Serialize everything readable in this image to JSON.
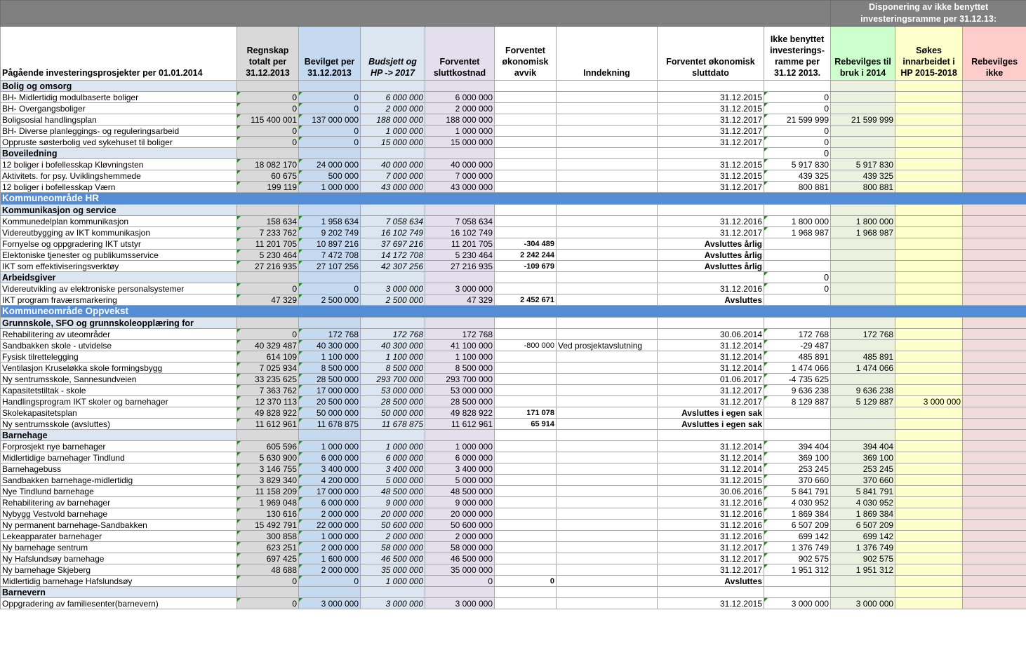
{
  "top_header": {
    "disposition": "Disponering  av ikke benyttet investeringsramme per 31.12.13:"
  },
  "columns": {
    "project": "Pågående investeringsprosjekter per 01.01.2014",
    "regnskap": "Regnskap totalt per 31.12.2013",
    "bevilget": "Bevilget per 31.12.2013",
    "budsjett": "Budsjett og HP -> 2017",
    "forventet_kost": "Forventet sluttkostnad",
    "forventet_avvik": "Forventet økonomisk avvik",
    "inndekning": "Inndekning",
    "sluttdato": "Forventet økonomisk sluttdato",
    "ikke_benyttet": "Ikke benyttet investerings-ramme per 31.12 2013.",
    "rebevilges_2014": "Rebevilges til bruk i 2014",
    "sokes_hp": "Søkes innarbeidet i HP 2015-2018",
    "rebevilges_ikke": "Rebevilges ikke"
  },
  "rows": [
    {
      "t": "sec",
      "name": "Bolig og omsorg"
    },
    {
      "t": "d",
      "name": "BH- Midlertidig modulbaserte boliger",
      "r": "0",
      "bv": "0",
      "bu": "6 000 000",
      "fk": "6 000 000",
      "av": "",
      "in": "",
      "sd": "31.12.2015",
      "ib": "0",
      "rb": "",
      "sk": "",
      "rk": ""
    },
    {
      "t": "d",
      "name": "BH- Overgangsboliger",
      "r": "0",
      "bv": "0",
      "bu": "2 000 000",
      "fk": "2 000 000",
      "av": "",
      "in": "",
      "sd": "31.12.2015",
      "ib": "0",
      "rb": "",
      "sk": "",
      "rk": ""
    },
    {
      "t": "d",
      "name": "Boligsosial handlingsplan",
      "r": "115 400 001",
      "bv": "137 000 000",
      "bu": "188 000 000",
      "fk": "188 000 000",
      "av": "",
      "in": "",
      "sd": "31.12.2017",
      "ib": "21 599 999",
      "rb": "21 599 999",
      "sk": "",
      "rk": ""
    },
    {
      "t": "d",
      "name": "BH- Diverse planleggings- og reguleringsarbeid",
      "r": "0",
      "bv": "0",
      "bu": "1 000 000",
      "fk": "1 000 000",
      "av": "",
      "in": "",
      "sd": "31.12.2017",
      "ib": "0",
      "rb": "",
      "sk": "",
      "rk": ""
    },
    {
      "t": "d",
      "name": "Oppruste søsterbolig ved sykehuset til boliger",
      "r": "0",
      "bv": "0",
      "bu": "15 000 000",
      "fk": "15 000 000",
      "av": "",
      "in": "",
      "sd": "31.12.2017",
      "ib": "0",
      "rb": "",
      "sk": "",
      "rk": ""
    },
    {
      "t": "sec",
      "name": "Boveiledning",
      "ib": "0"
    },
    {
      "t": "d",
      "name": "12 boliger i bofellesskap Kløvningsten",
      "r": "18 082 170",
      "bv": "24 000 000",
      "bu": "40 000 000",
      "fk": "40 000 000",
      "av": "",
      "in": "",
      "sd": "31.12.2015",
      "ib": "5 917 830",
      "rb": "5 917 830",
      "sk": "",
      "rk": ""
    },
    {
      "t": "d",
      "name": "Aktivitets. for psy. Uviklingshemmede",
      "r": "60 675",
      "bv": "500 000",
      "bu": "7 000 000",
      "fk": "7 000 000",
      "av": "",
      "in": "",
      "sd": "31.12.2015",
      "ib": "439 325",
      "rb": "439 325",
      "sk": "",
      "rk": ""
    },
    {
      "t": "d",
      "name": "12 boliger i bofellesskap Værn",
      "r": "199 119",
      "bv": "1 000 000",
      "bu": "43 000 000",
      "fk": "43 000 000",
      "av": "",
      "in": "",
      "sd": "31.12.2017",
      "ib": "800 881",
      "rb": "800 881",
      "sk": "",
      "rk": ""
    },
    {
      "t": "area",
      "name": "Kommuneområde HR"
    },
    {
      "t": "sec",
      "name": "Kommunikasjon og service"
    },
    {
      "t": "d",
      "name": "Kommunedelplan kommunikasjon",
      "r": "158 634",
      "bv": "1 958 634",
      "bu": "7 058 634",
      "fk": "7 058 634",
      "av": "",
      "in": "",
      "sd": "31.12.2016",
      "ib": "1 800 000",
      "rb": "1 800 000",
      "sk": "",
      "rk": ""
    },
    {
      "t": "d",
      "name": "Videreutbygging av IKT kommunikasjon",
      "r": "7 233 762",
      "bv": "9 202 749",
      "bu": "16 102 749",
      "fk": "16 102 749",
      "av": "",
      "in": "",
      "sd": "31.12.2017",
      "ib": "1 968 987",
      "rb": "1 968 987",
      "sk": "",
      "rk": ""
    },
    {
      "t": "d",
      "name": "Fornyelse og oppgradering IKT utstyr",
      "r": "11 201 705",
      "bv": "10 897 216",
      "bu": "37 697 216",
      "fk": "11 201 705",
      "av": "-304 489",
      "avb": true,
      "in": "",
      "sd": "Avsluttes årlig",
      "sdb": true,
      "ib": "",
      "rb": "",
      "sk": "",
      "rk": ""
    },
    {
      "t": "d",
      "name": "Elektoniske tjenester og publikumsservice",
      "r": "5 230 464",
      "bv": "7 472 708",
      "bu": "14 172 708",
      "fk": "5 230 464",
      "av": "2 242 244",
      "avb": true,
      "in": "",
      "sd": "Avsluttes årlig",
      "sdb": true,
      "ib": "",
      "rb": "",
      "sk": "",
      "rk": ""
    },
    {
      "t": "d",
      "name": "IKT som effektiviseringsverktøy",
      "r": "27 216 935",
      "bv": "27 107 256",
      "bu": "42 307 256",
      "fk": "27 216 935",
      "av": "-109 679",
      "avb": true,
      "in": "",
      "sd": "Avsluttes årlig",
      "sdb": true,
      "ib": "",
      "rb": "",
      "sk": "",
      "rk": ""
    },
    {
      "t": "sec",
      "name": "Arbeidsgiver",
      "ib": "0"
    },
    {
      "t": "d",
      "name": "Videreutvikling av elektroniske personalsystemer",
      "r": "0",
      "bv": "0",
      "bu": "3 000 000",
      "fk": "3 000 000",
      "av": "",
      "in": "",
      "sd": "31.12.2016",
      "ib": "0",
      "rb": "",
      "sk": "",
      "rk": ""
    },
    {
      "t": "d",
      "name": "IKT program fraværsmarkering",
      "r": "47 329",
      "bv": "2 500 000",
      "bu": "2 500 000",
      "fk": "47 329",
      "av": "2 452 671",
      "avb": true,
      "in": "",
      "sd": "Avsluttes",
      "sdb": true,
      "ib": "",
      "rb": "",
      "sk": "",
      "rk": ""
    },
    {
      "t": "area",
      "name": "Kommuneområde Oppvekst"
    },
    {
      "t": "sec",
      "name": "Grunnskole, SFO og grunnskoleopplæring for"
    },
    {
      "t": "d",
      "name": "Rehabilitering av uteområder",
      "r": "0",
      "bv": "172 768",
      "bu": "172 768",
      "fk": "172 768",
      "av": "",
      "in": "",
      "sd": "30.06.2014",
      "ib": "172 768",
      "rb": "172 768",
      "sk": "",
      "rk": ""
    },
    {
      "t": "d",
      "name": "Sandbakken skole - utvidelse",
      "r": "40 329 487",
      "bv": "40 300 000",
      "bu": "40 300 000",
      "fk": "41 100 000",
      "av": "-800 000",
      "in": "Ved prosjektavslutning",
      "sd": "31.12.2014",
      "ib": "-29 487",
      "rb": "",
      "sk": "",
      "rk": ""
    },
    {
      "t": "d",
      "name": "Fysisk tilrettelegging",
      "r": "614 109",
      "bv": "1 100 000",
      "bu": "1 100 000",
      "fk": "1 100 000",
      "av": "",
      "in": "",
      "sd": "31.12.2014",
      "ib": "485 891",
      "rb": "485 891",
      "sk": "",
      "rk": ""
    },
    {
      "t": "d",
      "name": "Ventilasjon Kruseløkka skole formingsbygg",
      "r": "7 025 934",
      "bv": "8 500 000",
      "bu": "8 500 000",
      "fk": "8 500 000",
      "av": "",
      "in": "",
      "sd": "31.12.2014",
      "ib": "1 474 066",
      "rb": "1 474 066",
      "sk": "",
      "rk": ""
    },
    {
      "t": "d",
      "name": "Ny sentrumsskole, Sannesundveien",
      "r": "33 235 625",
      "bv": "28 500 000",
      "bu": "293 700 000",
      "fk": "293 700 000",
      "av": "",
      "in": "",
      "sd": "01.06.2017",
      "ib": "-4 735 625",
      "rb": "",
      "sk": "",
      "rk": ""
    },
    {
      "t": "d",
      "name": "Kapasitetstiltak - skole",
      "r": "7 363 762",
      "bv": "17 000 000",
      "bu": "53 000 000",
      "fk": "53 000 000",
      "av": "",
      "in": "",
      "sd": "31.12.2017",
      "ib": "9 636 238",
      "rb": "9 636 238",
      "sk": "",
      "rk": ""
    },
    {
      "t": "d",
      "name": "Handlingsprogram IKT skoler og barnehager",
      "r": "12 370 113",
      "bv": "20 500 000",
      "bu": "28 500 000",
      "fk": "28 500 000",
      "av": "",
      "in": "",
      "sd": "31.12.2017",
      "ib": "8 129 887",
      "rb": "5 129 887",
      "sk": "3 000 000",
      "rk": ""
    },
    {
      "t": "d",
      "name": "Skolekapasitetsplan",
      "r": "49 828 922",
      "bv": "50 000 000",
      "bu": "50 000 000",
      "fk": "49 828 922",
      "av": "171 078",
      "avb": true,
      "in": "",
      "sd": "Avsluttes i egen sak",
      "sdb": true,
      "ib": "",
      "rb": "",
      "sk": "",
      "rk": ""
    },
    {
      "t": "d",
      "name": "Ny sentrumsskole (avsluttes)",
      "r": "11 612 961",
      "bv": "11 678 875",
      "bu": "11 678 875",
      "fk": "11 612 961",
      "av": "65 914",
      "avb": true,
      "in": "",
      "sd": "Avsluttes i egen sak",
      "sdb": true,
      "ib": "",
      "rb": "",
      "sk": "",
      "rk": ""
    },
    {
      "t": "sec",
      "name": "Barnehage"
    },
    {
      "t": "d",
      "name": "Forprosjekt nye barnehager",
      "r": "605 596",
      "bv": "1 000 000",
      "bu": "1 000 000",
      "fk": "1 000 000",
      "av": "",
      "in": "",
      "sd": "31.12.2014",
      "ib": "394 404",
      "rb": "394 404",
      "sk": "",
      "rk": ""
    },
    {
      "t": "d",
      "name": "Midlertidige barnehager Tindlund",
      "r": "5 630 900",
      "bv": "6 000 000",
      "bu": "6 000 000",
      "fk": "6 000 000",
      "av": "",
      "in": "",
      "sd": "31.12.2014",
      "ib": "369 100",
      "rb": "369 100",
      "sk": "",
      "rk": ""
    },
    {
      "t": "d",
      "name": "Barnehagebuss",
      "r": "3 146 755",
      "bv": "3 400 000",
      "bu": "3 400 000",
      "fk": "3 400 000",
      "av": "",
      "in": "",
      "sd": "31.12.2014",
      "ib": "253 245",
      "rb": "253 245",
      "sk": "",
      "rk": ""
    },
    {
      "t": "d",
      "name": "Sandbakken barnehage-midlertidig",
      "r": "3 829 340",
      "bv": "4 200 000",
      "bu": "5 000 000",
      "fk": "5 000 000",
      "av": "",
      "in": "",
      "sd": "31.12.2015",
      "ib": "370 660",
      "rb": "370 660",
      "sk": "",
      "rk": ""
    },
    {
      "t": "d",
      "name": "Nye Tindlund barnehage",
      "r": "11 158 209",
      "bv": "17 000 000",
      "bu": "48 500 000",
      "fk": "48 500 000",
      "av": "",
      "in": "",
      "sd": "30.06.2016",
      "ib": "5 841 791",
      "rb": "5 841 791",
      "sk": "",
      "rk": ""
    },
    {
      "t": "d",
      "name": "Rehabilitering av barnehager",
      "r": "1 969 048",
      "bv": "6 000 000",
      "bu": "9 000 000",
      "fk": "9 000 000",
      "av": "",
      "in": "",
      "sd": "31.12.2016",
      "ib": "4 030 952",
      "rb": "4 030 952",
      "sk": "",
      "rk": ""
    },
    {
      "t": "d",
      "name": "Nybygg Vestvold barnehage",
      "r": "130 616",
      "bv": "2 000 000",
      "bu": "20 000 000",
      "fk": "20 000 000",
      "av": "",
      "in": "",
      "sd": "31.12.2016",
      "ib": "1 869 384",
      "rb": "1 869 384",
      "sk": "",
      "rk": ""
    },
    {
      "t": "d",
      "name": "Ny permanent barnehage-Sandbakken",
      "r": "15 492 791",
      "bv": "22 000 000",
      "bu": "50 600 000",
      "fk": "50 600 000",
      "av": "",
      "in": "",
      "sd": "31.12.2016",
      "ib": "6 507 209",
      "rb": "6 507 209",
      "sk": "",
      "rk": ""
    },
    {
      "t": "d",
      "name": "Lekeapparater barnehager",
      "r": "300 858",
      "bv": "1 000 000",
      "bu": "2 000 000",
      "fk": "2 000 000",
      "av": "",
      "in": "",
      "sd": "31.12.2016",
      "ib": "699 142",
      "rb": "699 142",
      "sk": "",
      "rk": ""
    },
    {
      "t": "d",
      "name": "Ny barnehage sentrum",
      "r": "623 251",
      "bv": "2 000 000",
      "bu": "58 000 000",
      "fk": "58 000 000",
      "av": "",
      "in": "",
      "sd": "31.12.2017",
      "ib": "1 376 749",
      "rb": "1 376 749",
      "sk": "",
      "rk": ""
    },
    {
      "t": "d",
      "name": "Ny Hafslundsøy barnehage",
      "r": "697 425",
      "bv": "1 600 000",
      "bu": "46 500 000",
      "fk": "46 500 000",
      "av": "",
      "in": "",
      "sd": "31.12.2017",
      "ib": "902 575",
      "rb": "902 575",
      "sk": "",
      "rk": ""
    },
    {
      "t": "d",
      "name": "Ny barnehage Skjeberg",
      "r": "48 688",
      "bv": "2 000 000",
      "bu": "35 000 000",
      "fk": "35 000 000",
      "av": "",
      "in": "",
      "sd": "31.12.2017",
      "ib": "1 951 312",
      "rb": "1 951 312",
      "sk": "",
      "rk": ""
    },
    {
      "t": "d",
      "name": "Midlertidig barnehage Hafslundsøy",
      "r": "0",
      "bv": "0",
      "bu": "1 000 000",
      "fk": "0",
      "av": "0",
      "avb": true,
      "in": "",
      "sd": "Avsluttes",
      "sdb": true,
      "ib": "",
      "rb": "",
      "sk": "",
      "rk": ""
    },
    {
      "t": "sec",
      "name": "Barnevern"
    },
    {
      "t": "d",
      "name": "Oppgradering av familiesenter(barnevern)",
      "r": "0",
      "bv": "3 000 000",
      "bu": "3 000 000",
      "fk": "3 000 000",
      "av": "",
      "in": "",
      "sd": "31.12.2015",
      "ib": "3 000 000",
      "rb": "3 000 000",
      "sk": "",
      "rk": ""
    }
  ]
}
